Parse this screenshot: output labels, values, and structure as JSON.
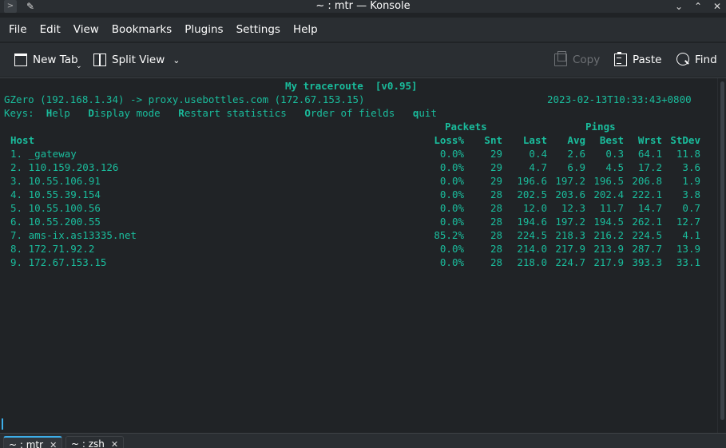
{
  "window": {
    "title": "~ : mtr — Konsole"
  },
  "menu": [
    "File",
    "Edit",
    "View",
    "Bookmarks",
    "Plugins",
    "Settings",
    "Help"
  ],
  "toolbar": {
    "new_tab": "New Tab",
    "split_view": "Split View",
    "copy": "Copy",
    "paste": "Paste",
    "find": "Find"
  },
  "terminal": {
    "header": "My traceroute  [v0.95]",
    "route": "GZero (192.168.1.34) -> proxy.usebottles.com (172.67.153.15)",
    "timestamp": "2023-02-13T10:33:43+0800",
    "keys_label": "Keys:",
    "keys": [
      {
        "key": "H",
        "rest": "elp"
      },
      {
        "key": "D",
        "rest": "isplay mode"
      },
      {
        "key": "R",
        "rest": "estart statistics"
      },
      {
        "key": "O",
        "rest": "rder of fields"
      },
      {
        "key": "q",
        "rest": "uit"
      }
    ],
    "group_packets": "Packets",
    "group_pings": "Pings",
    "columns": {
      "host": "Host",
      "loss": "Loss%",
      "snt": "Snt",
      "last": "Last",
      "avg": "Avg",
      "best": "Best",
      "wrst": "Wrst",
      "stdev": "StDev"
    },
    "rows": [
      {
        "host": "1. _gateway",
        "loss": "0.0%",
        "snt": "29",
        "last": "0.4",
        "avg": "2.6",
        "best": "0.3",
        "wrst": "64.1",
        "stdev": "11.8"
      },
      {
        "host": "2. 110.159.203.126",
        "loss": "0.0%",
        "snt": "29",
        "last": "4.7",
        "avg": "6.9",
        "best": "4.5",
        "wrst": "17.2",
        "stdev": "3.6"
      },
      {
        "host": "3. 10.55.106.91",
        "loss": "0.0%",
        "snt": "29",
        "last": "196.6",
        "avg": "197.2",
        "best": "196.5",
        "wrst": "206.8",
        "stdev": "1.9"
      },
      {
        "host": "4. 10.55.39.154",
        "loss": "0.0%",
        "snt": "28",
        "last": "202.5",
        "avg": "203.6",
        "best": "202.4",
        "wrst": "222.1",
        "stdev": "3.8"
      },
      {
        "host": "5. 10.55.100.56",
        "loss": "0.0%",
        "snt": "28",
        "last": "12.0",
        "avg": "12.3",
        "best": "11.7",
        "wrst": "14.7",
        "stdev": "0.7"
      },
      {
        "host": "6. 10.55.200.55",
        "loss": "0.0%",
        "snt": "28",
        "last": "194.6",
        "avg": "197.2",
        "best": "194.5",
        "wrst": "262.1",
        "stdev": "12.7"
      },
      {
        "host": "7. ams-ix.as13335.net",
        "loss": "85.2%",
        "snt": "28",
        "last": "224.5",
        "avg": "218.3",
        "best": "216.2",
        "wrst": "224.5",
        "stdev": "4.1"
      },
      {
        "host": "8. 172.71.92.2",
        "loss": "0.0%",
        "snt": "28",
        "last": "214.0",
        "avg": "217.9",
        "best": "213.9",
        "wrst": "287.7",
        "stdev": "13.9"
      },
      {
        "host": "9. 172.67.153.15",
        "loss": "0.0%",
        "snt": "28",
        "last": "218.0",
        "avg": "224.7",
        "best": "217.9",
        "wrst": "393.3",
        "stdev": "33.1"
      }
    ]
  },
  "tabs": [
    {
      "label": "~ : mtr"
    },
    {
      "label": "~ : zsh"
    }
  ],
  "colors": {
    "terminal_text": "#1abc9c",
    "background": "#202326",
    "chrome": "#2a2e32",
    "accent": "#3daee9"
  }
}
